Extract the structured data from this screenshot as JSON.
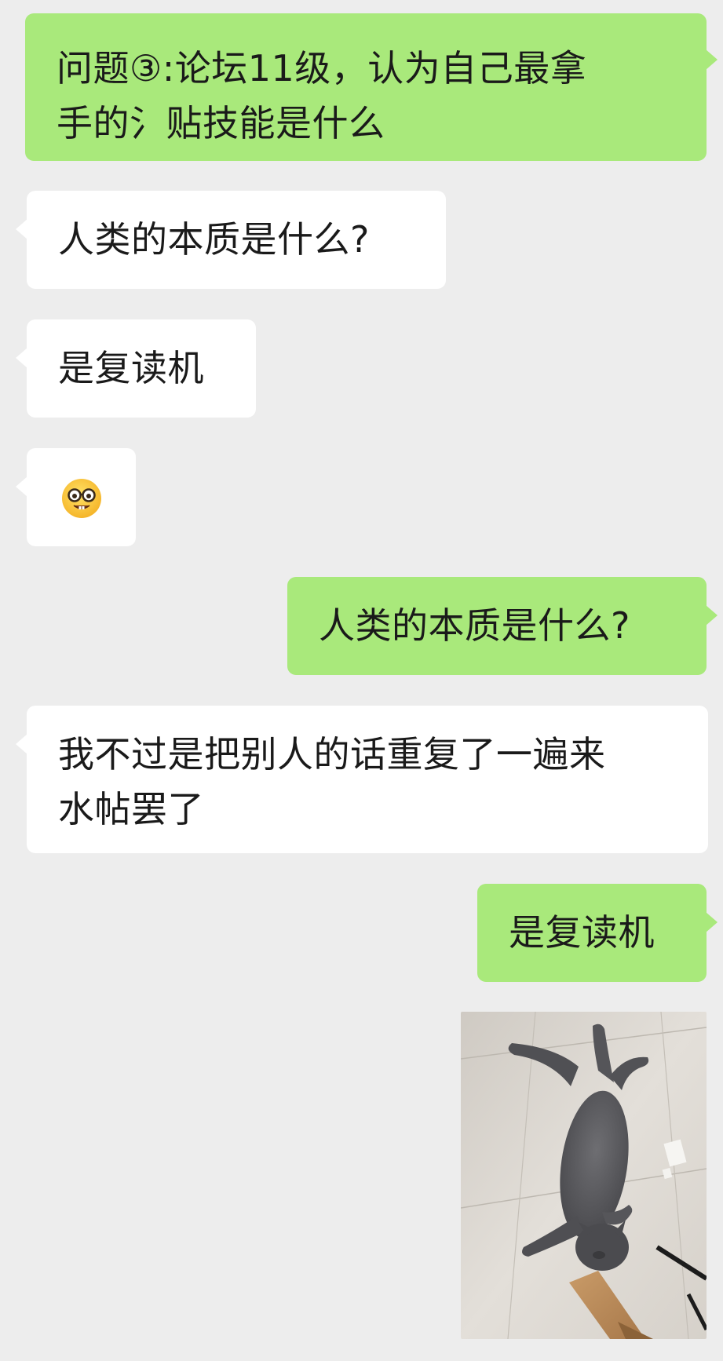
{
  "messages": [
    {
      "id": 1,
      "side": "right",
      "kind": "text",
      "text": "问题③:论坛11级，认为自己最拿\n手的氵贴技能是什么"
    },
    {
      "id": 2,
      "side": "left",
      "kind": "text",
      "text": "人类的本质是什么?"
    },
    {
      "id": 3,
      "side": "left",
      "kind": "text",
      "text": "是复读机"
    },
    {
      "id": 4,
      "side": "left",
      "kind": "emoji",
      "emoji": "nerd-face-icon"
    },
    {
      "id": 5,
      "side": "right",
      "kind": "text",
      "text": "人类的本质是什么?"
    },
    {
      "id": 6,
      "side": "left",
      "kind": "text",
      "text": "我不过是把别人的话重复了一遍来\n水帖罢了"
    },
    {
      "id": 7,
      "side": "right",
      "kind": "text",
      "text": "是复读机"
    },
    {
      "id": 8,
      "side": "right",
      "kind": "image",
      "image": "cat-on-floor-photo"
    }
  ],
  "colors": {
    "background": "#ededed",
    "sent_bubble": "#a9e97b",
    "received_bubble": "#ffffff",
    "text": "#1a1a1a"
  }
}
